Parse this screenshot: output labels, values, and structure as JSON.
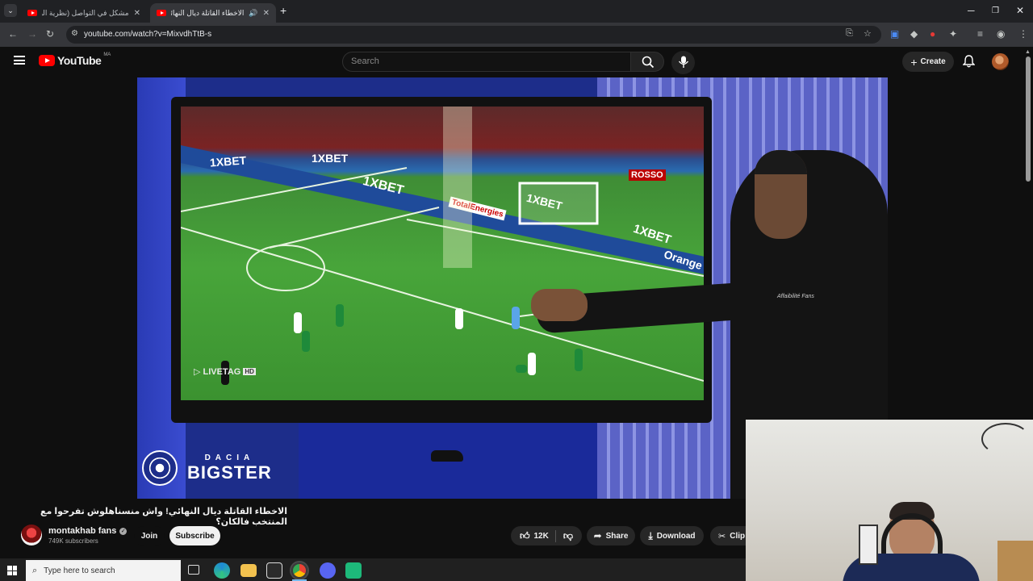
{
  "browser": {
    "tabs": [
      {
        "label": "مشكل في التواصل (نظرية البراك...",
        "active": false
      },
      {
        "label": "الاخطاء القاتلة ديال النهائي! و",
        "active": true
      }
    ],
    "new_tab": "+",
    "url": "youtube.com/watch?v=MixvdhTtB-s"
  },
  "youtube": {
    "logo_text": "YouTube",
    "region": "MA",
    "search_placeholder": "Search",
    "create_label": "Create"
  },
  "video": {
    "title": "الاخطاء القاتلة ديال النهائي! واش منسناهلوش تفرحوا مع المنتخب فالكان؟",
    "overlay_brand_top": "DACIA",
    "overlay_brand": "BIGSTER",
    "screen_watermark": "LIVETAG",
    "screen_watermark_hd": "HD",
    "pitch_ads": [
      "1XBET",
      "1XBET",
      "1XBET",
      "1XBET",
      "1XBET"
    ],
    "pitch_sponsor": "Orange",
    "pitch_energy": "TotalEnergies",
    "pitch_rosso": "ROSSO",
    "hoodie_text": "Affaibilité Fans"
  },
  "channel": {
    "name": "montakhab fans",
    "verified": true,
    "subscribers": "749K subscribers",
    "join_label": "Join",
    "subscribe_label": "Subscribe"
  },
  "actions": {
    "likes": "12K",
    "share_label": "Share",
    "download_label": "Download",
    "clip_label": "Clip"
  },
  "taskbar": {
    "search_placeholder": "Type here to search"
  },
  "colors": {
    "yt_red": "#ff0000",
    "page_bg": "#0f0f0f",
    "chrome_bg": "#202124"
  }
}
